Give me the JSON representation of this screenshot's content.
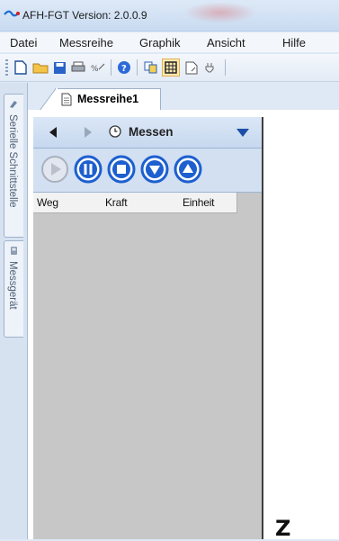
{
  "window": {
    "title": "AFH-FGT  Version: 2.0.0.9"
  },
  "menu": {
    "items": [
      {
        "label": "Datei"
      },
      {
        "label": "Messreihe"
      },
      {
        "label": "Graphik"
      },
      {
        "label": "Ansicht"
      },
      {
        "label": "Hilfe"
      }
    ]
  },
  "toolbar": {
    "buttons": [
      {
        "icon": "new-document-icon"
      },
      {
        "icon": "open-folder-icon"
      },
      {
        "icon": "save-icon"
      },
      {
        "icon": "print-icon"
      },
      {
        "icon": "scale-icon"
      },
      {
        "icon": "help-icon"
      },
      {
        "icon": "copy-icon"
      },
      {
        "icon": "grid-icon",
        "active": true
      },
      {
        "icon": "export-icon"
      },
      {
        "icon": "connect-icon"
      }
    ]
  },
  "side_tabs": [
    {
      "label": "Serielle Schnittstelle",
      "icon": "serial-icon"
    },
    {
      "label": "Messgerät",
      "icon": "device-icon"
    }
  ],
  "document": {
    "tab_label": "Messreihe1"
  },
  "panel": {
    "mode_label": "Messen",
    "controls": [
      {
        "icon": "play-icon",
        "enabled": false
      },
      {
        "icon": "pause-icon",
        "enabled": true
      },
      {
        "icon": "stop-icon",
        "enabled": true
      },
      {
        "icon": "down-icon",
        "enabled": true
      },
      {
        "icon": "up-icon",
        "enabled": true
      }
    ],
    "table": {
      "columns": [
        "Weg",
        "Kraft",
        "Einheit"
      ],
      "rows": []
    }
  },
  "canvas": {
    "mark": "Z"
  },
  "colors": {
    "accent": "#1d5fcf",
    "panel_bg": "#c7c7c7"
  }
}
